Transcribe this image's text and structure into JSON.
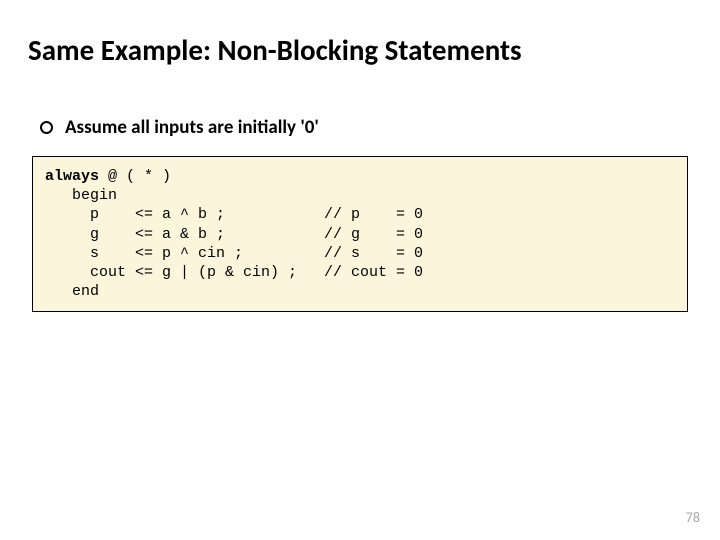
{
  "title": "Same Example: Non-Blocking Statements",
  "bullet": "Assume all inputs are initially '0'",
  "code": {
    "l1a": "always",
    "l1b": " @ ( * )",
    "l2": "   begin",
    "l3": "     p    <= a ^ b ;           // p    = 0",
    "l4": "     g    <= a & b ;           // g    = 0",
    "l5": "     s    <= p ^ cin ;         // s    = 0",
    "l6": "     cout <= g | (p & cin) ;   // cout = 0",
    "l7": "   end"
  },
  "page": "78"
}
